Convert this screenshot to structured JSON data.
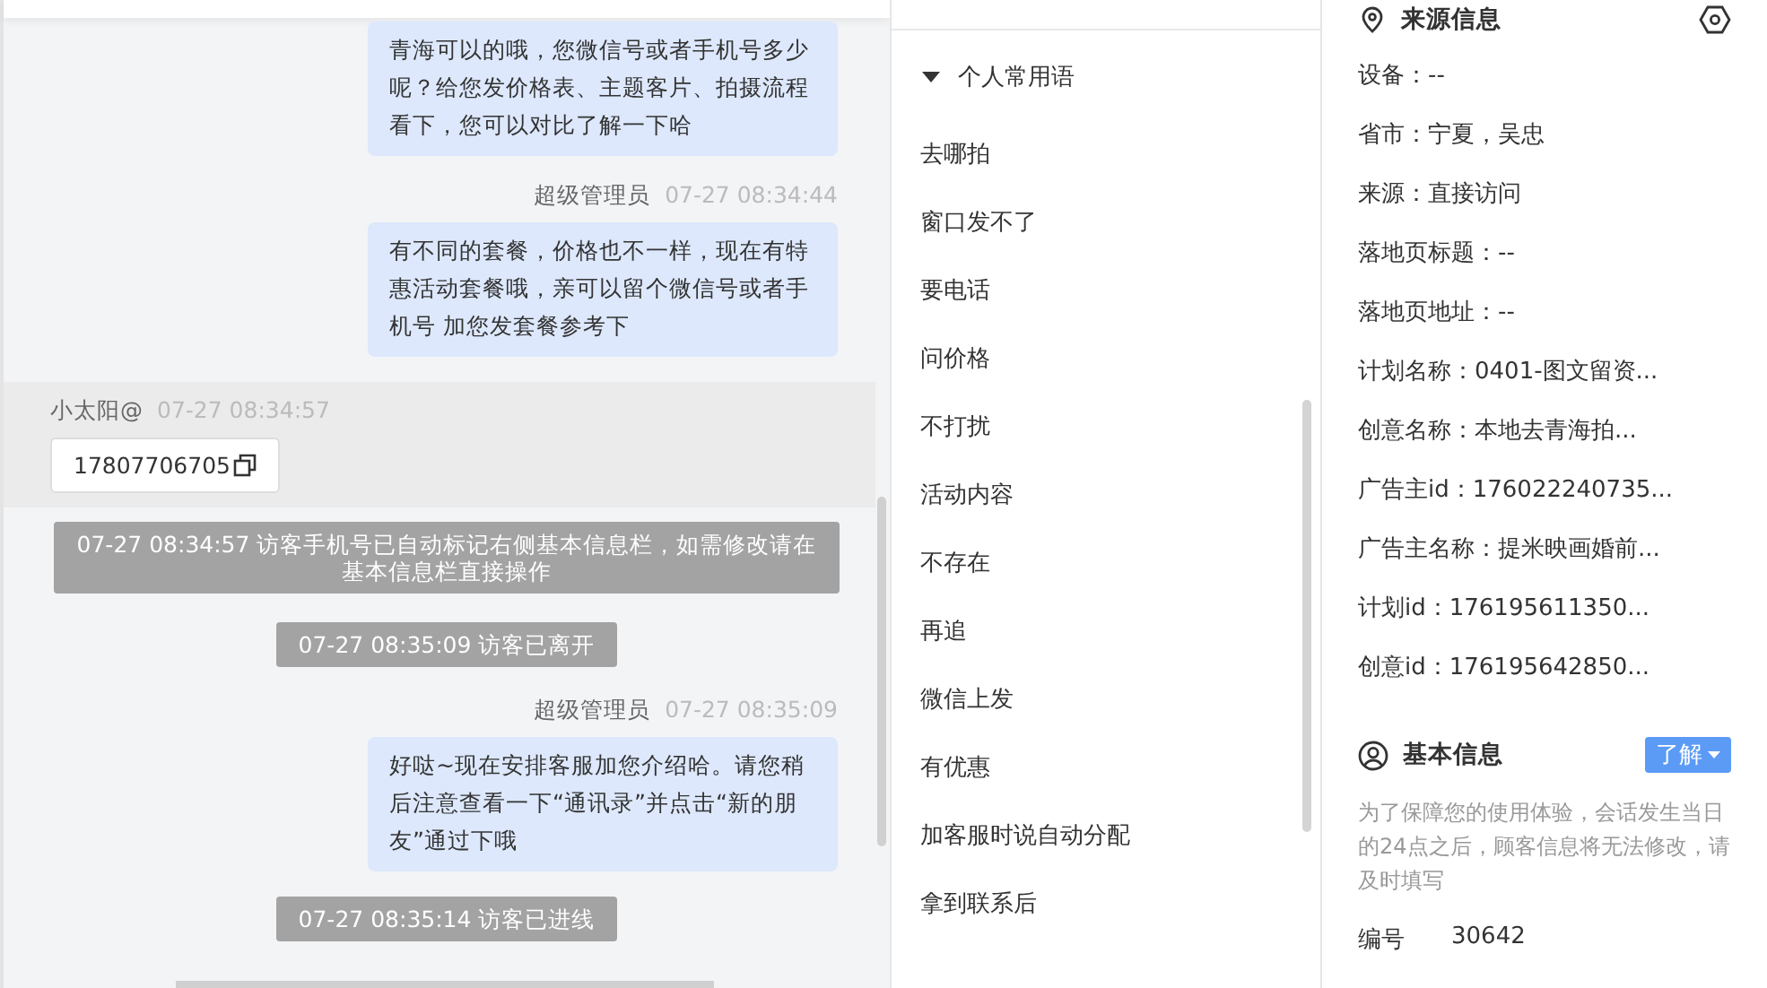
{
  "chat": {
    "messages": [
      {
        "kind": "agent",
        "text": "青海可以的哦，您微信号或者手机号多少呢？给您发价格表、主题客片、拍摄流程看下，您可以对比了解一下哈"
      },
      {
        "kind": "agent",
        "sender": "超级管理员",
        "time": "07-27 08:34:44",
        "text": "有不同的套餐，价格也不一样，现在有特惠活动套餐哦，亲可以留个微信号或者手机号 加您发套餐参考下"
      },
      {
        "kind": "visitor",
        "sender": "小太阳@",
        "time": "07-27 08:34:57",
        "text": "17807706705"
      },
      {
        "kind": "system",
        "text": "07-27 08:34:57 访客手机号已自动标记右侧基本信息栏，如需修改请在基本信息栏直接操作"
      },
      {
        "kind": "system",
        "text": "07-27 08:35:09 访客已离开"
      },
      {
        "kind": "agent",
        "sender": "超级管理员",
        "time": "07-27 08:35:09",
        "text": "好哒~现在安排客服加您介绍哈。请您稍后注意查看一下“通讯录”并点击“新的朋友”通过下哦"
      },
      {
        "kind": "system",
        "text": "07-27 08:35:14 访客已进线"
      }
    ]
  },
  "phrases": {
    "title": "个人常用语",
    "expanded": true,
    "items": [
      "去哪拍",
      "窗口发不了",
      "要电话",
      "问价格",
      "不打扰",
      "活动内容",
      "不存在",
      "再追",
      "微信上发",
      "有优惠",
      "加客服时说自动分配",
      "拿到联系后"
    ]
  },
  "source_info": {
    "title": "来源信息",
    "fields": [
      "设备：--",
      "省市：宁夏，吴忠",
      "来源：直接访问",
      "落地页标题：--",
      "落地页地址：--",
      "计划名称：0401-图文留资...",
      "创意名称：本地去青海拍...",
      "广告主id：176022240735...",
      "广告主名称：提米映画婚前...",
      "计划id：176195611350...",
      "创意id：176195642850..."
    ]
  },
  "basic_info": {
    "title": "基本信息",
    "button": "了解",
    "notice": "为了保障您的使用体验，会话发生当日的24点之后，顾客信息将无法修改，请及时填写",
    "fields": [
      {
        "label": "编号",
        "value": "30642"
      }
    ]
  }
}
